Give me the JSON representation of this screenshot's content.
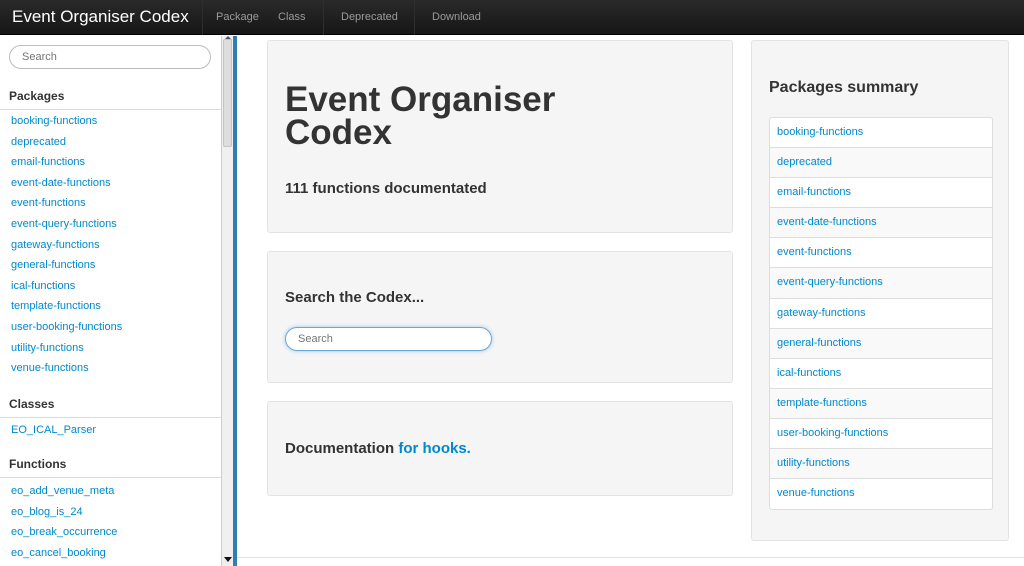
{
  "navbar": {
    "brand": "Event Organiser Codex",
    "items": [
      "Package",
      "Class",
      "Deprecated",
      "Download"
    ]
  },
  "sidebar": {
    "search_placeholder": "Search",
    "packages_heading": "Packages",
    "packages": [
      "booking-functions",
      "deprecated",
      "email-functions",
      "event-date-functions",
      "event-functions",
      "event-query-functions",
      "gateway-functions",
      "general-functions",
      "ical-functions",
      "template-functions",
      "user-booking-functions",
      "utility-functions",
      "venue-functions"
    ],
    "classes_heading": "Classes",
    "classes": [
      "EO_ICAL_Parser"
    ],
    "functions_heading": "Functions",
    "functions": [
      "eo_add_venue_meta",
      "eo_blog_is_24",
      "eo_break_occurrence",
      "eo_cancel_booking"
    ]
  },
  "main": {
    "title": "Event Organiser Codex",
    "subtitle": "111 functions documentated",
    "search_heading": "Search the Codex...",
    "search_placeholder": "Search",
    "docs_text": "Documentation",
    "docs_link": "for hooks."
  },
  "summary": {
    "title": "Packages summary",
    "packages": [
      "booking-functions",
      "deprecated",
      "email-functions",
      "event-date-functions",
      "event-functions",
      "event-query-functions",
      "gateway-functions",
      "general-functions",
      "ical-functions",
      "template-functions",
      "user-booking-functions",
      "utility-functions",
      "venue-functions"
    ]
  },
  "colors": {
    "link": "#0088cc",
    "navbar": "#1b1b1b",
    "accent": "#2f7eb8"
  }
}
